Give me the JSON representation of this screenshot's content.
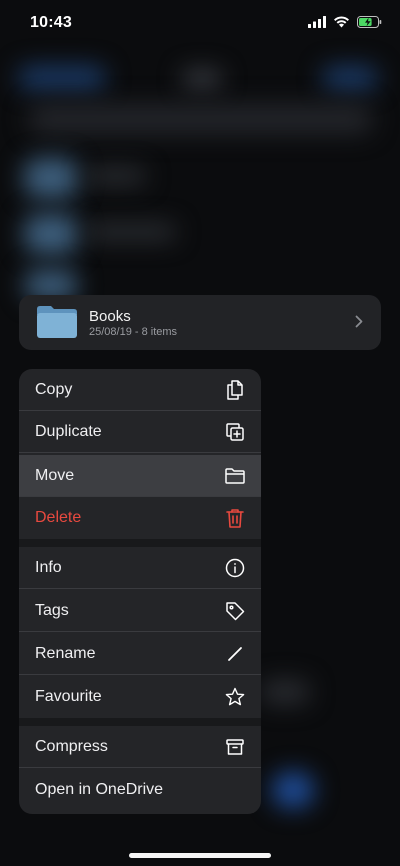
{
  "status_bar": {
    "time": "10:43",
    "battery_level": 0.7
  },
  "folder_card": {
    "name": "Books",
    "meta": "25/08/19 - 8 items"
  },
  "menu": {
    "copy": "Copy",
    "duplicate": "Duplicate",
    "move": "Move",
    "delete": "Delete",
    "info": "Info",
    "tags": "Tags",
    "rename": "Rename",
    "favourite": "Favourite",
    "compress": "Compress",
    "open_in": "Open in OneDrive"
  },
  "icons": {
    "copy": "document-copy-icon",
    "duplicate": "duplicate-plus-icon",
    "move": "folder-icon",
    "delete": "trash-icon",
    "info": "info-icon",
    "tags": "tag-icon",
    "rename": "pencil-icon",
    "favourite": "star-icon",
    "compress": "archive-box-icon"
  },
  "colors": {
    "accent": "#2f7cf6",
    "danger": "#e8493f",
    "folder": "#7fb2d6"
  }
}
